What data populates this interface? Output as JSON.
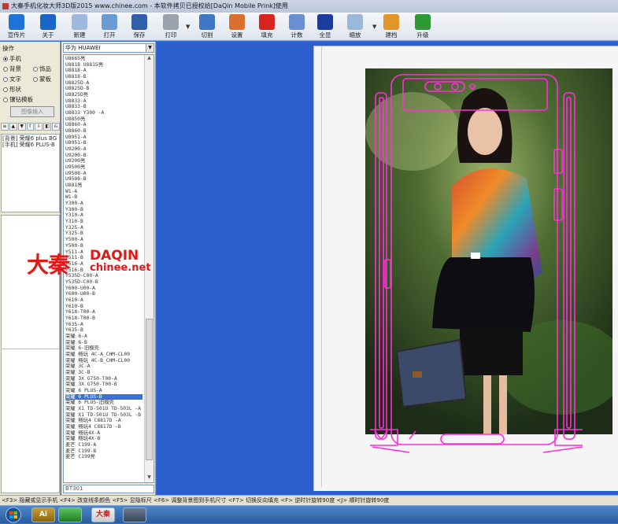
{
  "window": {
    "title": "大秦手机化妆大师3D版2015 www.chinee.com - 本软件拷贝已授权给[DaQin Mobile Prink]使用"
  },
  "toolbar": {
    "items": [
      {
        "label": "宣传片",
        "icon": "promo-video-icon"
      },
      {
        "label": "关于",
        "icon": "info-icon"
      },
      {
        "label": "新建",
        "icon": "new-document-icon"
      },
      {
        "label": "打开",
        "icon": "open-folder-icon"
      },
      {
        "label": "保存",
        "icon": "save-icon"
      },
      {
        "label": "打印",
        "icon": "printer-icon"
      },
      {
        "label": "切割",
        "icon": "cut-icon"
      },
      {
        "label": "设置",
        "icon": "settings-icon"
      },
      {
        "label": "填充",
        "icon": "fill-icon"
      },
      {
        "label": "计数",
        "icon": "count-icon"
      },
      {
        "label": "全显",
        "icon": "fullscreen-icon"
      },
      {
        "label": "缩放",
        "icon": "zoom-icon"
      },
      {
        "label": "建档",
        "icon": "archive-icon"
      },
      {
        "label": "升级",
        "icon": "upgrade-icon"
      }
    ]
  },
  "left_panel": {
    "section_title": "操作",
    "options": [
      {
        "label": "手机",
        "checked": true
      },
      {
        "label": "背景",
        "checked": false
      },
      {
        "label": "饰品",
        "checked": false
      },
      {
        "label": "文字",
        "checked": false
      },
      {
        "label": "蒙板",
        "checked": false
      },
      {
        "label": "形状",
        "checked": false
      },
      {
        "label": "镶钻模板",
        "checked": false
      }
    ],
    "image_button": "图像输入",
    "tags": [
      "[背景] 荣耀6 plus BG",
      "[手机] 荣耀6 PLUS-B"
    ]
  },
  "model_panel": {
    "brand": "华为  HUAWEI",
    "search": "BT301",
    "models": [
      "U8665亮",
      "U8818 U8815亮",
      "U8818-A",
      "U8818-B",
      "U8825D-A",
      "U8825D-B",
      "U8825D亮",
      "U8833-A",
      "U8833-B",
      "U8833 Y300 -A",
      "U8850亮",
      "U8860-A",
      "U8860-B",
      "U8951-A",
      "U8951-B",
      "U9200-A",
      "U9200-B",
      "U9200亮",
      "U9500亮",
      "U9508-A",
      "U9508-B",
      "U881亮",
      "W1-A",
      "W1-B",
      "Y300-A",
      "Y300-B",
      "Y310-A",
      "Y310-B",
      "Y325-A",
      "Y325-B",
      "Y500-A",
      "Y500-B",
      "Y511-A",
      "Y511-B",
      "Y516-A",
      "Y516-B",
      "Y535D-C00-A",
      "Y535D-C00-B",
      "Y600-U00-A",
      "Y600-U00-B",
      "Y610-A",
      "Y610-B",
      "Y618-T00-A",
      "Y618-T00-B",
      "Y635-A",
      "Y635-B",
      "荣耀 6-A",
      "荣耀 6-B",
      "荣耀 6-旧模壳",
      "荣耀 畅玩 4C-A_CHM-CL00",
      "荣耀 畅玩 4C-B_CHM-CL00",
      "荣耀 3C-A",
      "荣耀 3C-B",
      "荣耀 3X G750-T00-A",
      "荣耀 3X G750-T00-B",
      "荣耀 6 PLUS-A",
      "荣耀 6 PLUS-B",
      "荣耀 6 PLUS-旧模壳",
      "荣耀 X1 TD-501U TD-503L -A",
      "荣耀 X1 TD-501U TD-503L -B",
      "荣耀 畅玩4 C8817D -A",
      "荣耀 畅玩4 C8817D -B",
      "荣耀 畅玩4X-A",
      "荣耀 畅玩4X-B",
      "麦芒 C199-A",
      "麦芒 C199-B",
      "麦芒 C199亮"
    ],
    "selected_index": 56
  },
  "watermark": {
    "cn": "大秦",
    "en": "DAQIN",
    "url": "chinee.net"
  },
  "statusbar": {
    "text": "<F3> 隐藏或显示手机 <F4> 改变线条颜色 <F5> 显隐标尺 <F6> 调整背景图到手机尺寸 <F7> 切换反向填充 <F> 逆时针旋转90度 <J> 顺时针旋转90度"
  },
  "taskbar": {
    "items": [
      {
        "label": "",
        "icon": "windows-start-icon"
      },
      {
        "label": "",
        "icon": "windows-explorer-icon"
      },
      {
        "label": "Ai",
        "icon": "illustrator-icon"
      },
      {
        "label": "",
        "icon": "app-green-icon"
      },
      {
        "label": "大秦",
        "icon": "daqin-app-icon"
      },
      {
        "label": "",
        "icon": "media-icon"
      }
    ]
  },
  "colors": {
    "workspace_blue": "#2c5fce",
    "outline_magenta": "#ff2fd8",
    "watermark_red": "#e01818",
    "selection_blue": "#3a71d6"
  }
}
